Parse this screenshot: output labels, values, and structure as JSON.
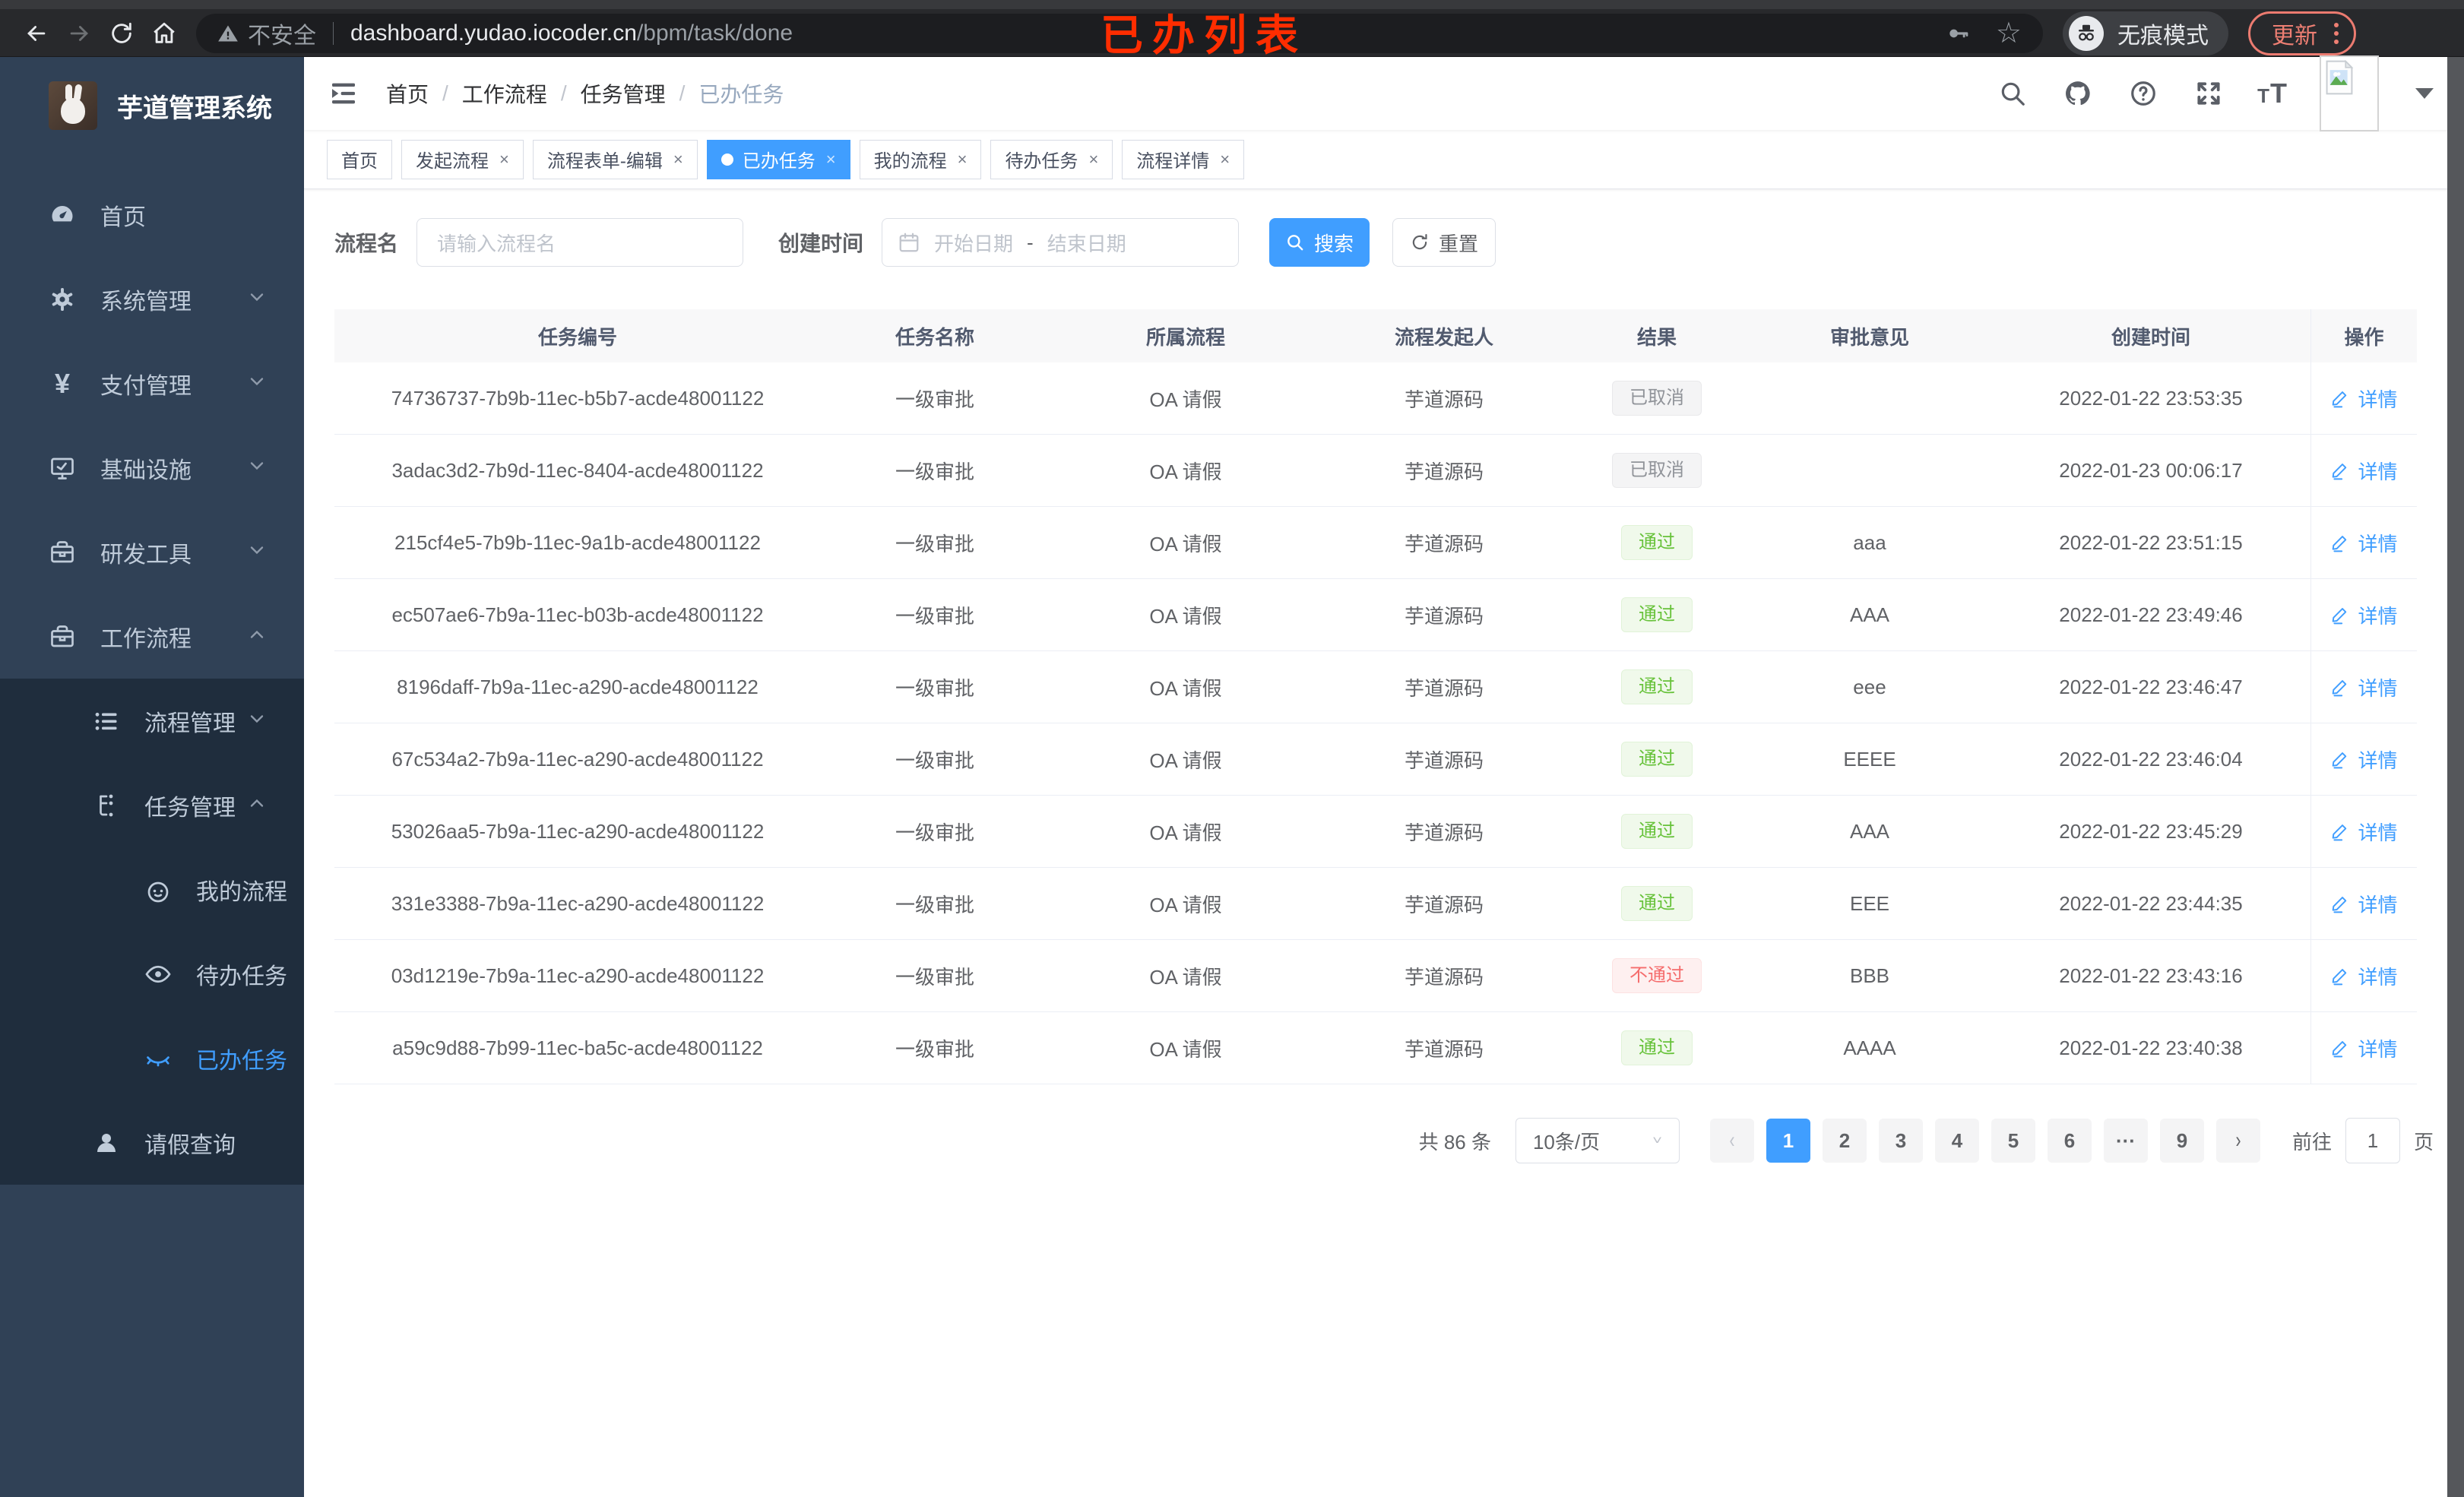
{
  "browser": {
    "security_label": "不安全",
    "url_domain": "dashboard.yudao.iocoder.cn",
    "url_path": "/bpm/task/done",
    "incognito_label": "无痕模式",
    "update_label": "更新"
  },
  "annotation": {
    "title": "已办列表",
    "color": "#ff2d00"
  },
  "colors": {
    "accent": "#409eff",
    "sidebar_bg": "#304156",
    "submenu_bg": "#1f2d3d",
    "success": "#67c23a",
    "danger": "#f56c6c",
    "info": "#909399"
  },
  "sidebar": {
    "app_title": "芋道管理系统",
    "menu": [
      {
        "label": "首页",
        "icon": "dashboard-icon"
      },
      {
        "label": "系统管理",
        "icon": "gear-icon"
      },
      {
        "label": "支付管理",
        "icon": "yen-icon"
      },
      {
        "label": "基础设施",
        "icon": "monitor-icon"
      },
      {
        "label": "研发工具",
        "icon": "toolbox-icon"
      },
      {
        "label": "工作流程",
        "icon": "briefcase-icon"
      }
    ],
    "workflow_children": [
      {
        "label": "流程管理",
        "icon": "list-icon"
      },
      {
        "label": "任务管理",
        "icon": "flow-icon"
      }
    ],
    "task_children": [
      {
        "label": "我的流程",
        "icon": "face-icon"
      },
      {
        "label": "待办任务",
        "icon": "eye-open-icon"
      },
      {
        "label": "已办任务",
        "icon": "eye-closed-icon",
        "active": true
      }
    ],
    "leave_item": {
      "label": "请假查询",
      "icon": "user-icon"
    }
  },
  "header": {
    "breadcrumb": [
      "首页",
      "工作流程",
      "任务管理",
      "已办任务"
    ],
    "separator": "/"
  },
  "tabs": [
    {
      "label": "首页"
    },
    {
      "label": "发起流程"
    },
    {
      "label": "流程表单-编辑"
    },
    {
      "label": "已办任务",
      "active": true
    },
    {
      "label": "我的流程"
    },
    {
      "label": "待办任务"
    },
    {
      "label": "流程详情"
    }
  ],
  "tab_close_glyph": "×",
  "filters": {
    "name_label": "流程名",
    "name_placeholder": "请输入流程名",
    "time_label": "创建时间",
    "start_placeholder": "开始日期",
    "range_separator": "-",
    "end_placeholder": "结束日期",
    "search_label": "搜索",
    "reset_label": "重置"
  },
  "table": {
    "columns": [
      "任务编号",
      "任务名称",
      "所属流程",
      "流程发起人",
      "结果",
      "审批意见",
      "创建时间",
      "操作"
    ],
    "detail_label": "详情",
    "rows": [
      {
        "id": "74736737-7b9b-11ec-b5b7-acde48001122",
        "name": "一级审批",
        "process": "OA 请假",
        "starter": "芋道源码",
        "result": "已取消",
        "result_type": "info",
        "comment": "",
        "time": "2022-01-22 23:53:35"
      },
      {
        "id": "3adac3d2-7b9d-11ec-8404-acde48001122",
        "name": "一级审批",
        "process": "OA 请假",
        "starter": "芋道源码",
        "result": "已取消",
        "result_type": "info",
        "comment": "",
        "time": "2022-01-23 00:06:17"
      },
      {
        "id": "215cf4e5-7b9b-11ec-9a1b-acde48001122",
        "name": "一级审批",
        "process": "OA 请假",
        "starter": "芋道源码",
        "result": "通过",
        "result_type": "success",
        "comment": "aaa",
        "time": "2022-01-22 23:51:15"
      },
      {
        "id": "ec507ae6-7b9a-11ec-b03b-acde48001122",
        "name": "一级审批",
        "process": "OA 请假",
        "starter": "芋道源码",
        "result": "通过",
        "result_type": "success",
        "comment": "AAA",
        "time": "2022-01-22 23:49:46"
      },
      {
        "id": "8196daff-7b9a-11ec-a290-acde48001122",
        "name": "一级审批",
        "process": "OA 请假",
        "starter": "芋道源码",
        "result": "通过",
        "result_type": "success",
        "comment": "eee",
        "time": "2022-01-22 23:46:47"
      },
      {
        "id": "67c534a2-7b9a-11ec-a290-acde48001122",
        "name": "一级审批",
        "process": "OA 请假",
        "starter": "芋道源码",
        "result": "通过",
        "result_type": "success",
        "comment": "EEEE",
        "time": "2022-01-22 23:46:04"
      },
      {
        "id": "53026aa5-7b9a-11ec-a290-acde48001122",
        "name": "一级审批",
        "process": "OA 请假",
        "starter": "芋道源码",
        "result": "通过",
        "result_type": "success",
        "comment": "AAA",
        "time": "2022-01-22 23:45:29"
      },
      {
        "id": "331e3388-7b9a-11ec-a290-acde48001122",
        "name": "一级审批",
        "process": "OA 请假",
        "starter": "芋道源码",
        "result": "通过",
        "result_type": "success",
        "comment": "EEE",
        "time": "2022-01-22 23:44:35"
      },
      {
        "id": "03d1219e-7b9a-11ec-a290-acde48001122",
        "name": "一级审批",
        "process": "OA 请假",
        "starter": "芋道源码",
        "result": "不通过",
        "result_type": "danger",
        "comment": "BBB",
        "time": "2022-01-22 23:43:16"
      },
      {
        "id": "a59c9d88-7b99-11ec-ba5c-acde48001122",
        "name": "一级审批",
        "process": "OA 请假",
        "starter": "芋道源码",
        "result": "通过",
        "result_type": "success",
        "comment": "AAAA",
        "time": "2022-01-22 23:40:38"
      }
    ]
  },
  "pagination": {
    "total_label": "共 86 条",
    "page_size": "10条/页",
    "pages": [
      "1",
      "2",
      "3",
      "4",
      "5",
      "6",
      "···",
      "9"
    ],
    "active_page": "1",
    "goto_label": "前往",
    "goto_value": "1",
    "page_unit": "页"
  }
}
